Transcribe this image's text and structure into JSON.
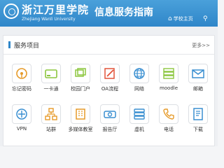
{
  "header": {
    "university_cn": "浙江万里学院",
    "university_en": "Zhejiang Wanli University",
    "site_title": "信息服务指南",
    "home_link": "学校主页",
    "logo_icon": "university-seal-icon",
    "home_icon": "home-icon",
    "search_icon": "search-icon",
    "brand_color": "#2f86c9"
  },
  "section": {
    "title": "服务项目",
    "more": "更多>>"
  },
  "services": [
    {
      "label": "忘记密码",
      "icon": "key-icon"
    },
    {
      "label": "一卡通",
      "icon": "card-icon"
    },
    {
      "label": "校园门户",
      "icon": "portal-icon"
    },
    {
      "label": "OA流程",
      "icon": "pen-document-icon"
    },
    {
      "label": "网络",
      "icon": "globe-icon"
    },
    {
      "label": "moodle",
      "icon": "server-list-icon"
    },
    {
      "label": "邮箱",
      "icon": "mail-icon"
    },
    {
      "label": "VPN",
      "icon": "vpn-icon"
    },
    {
      "label": "站群",
      "icon": "site-cluster-icon"
    },
    {
      "label": "多媒体教室",
      "icon": "building-icon"
    },
    {
      "label": "报告厅",
      "icon": "projector-icon"
    },
    {
      "label": "虚机",
      "icon": "virtual-machine-icon"
    },
    {
      "label": "电话",
      "icon": "phone-icon"
    },
    {
      "label": "下载",
      "icon": "download-icon"
    }
  ]
}
